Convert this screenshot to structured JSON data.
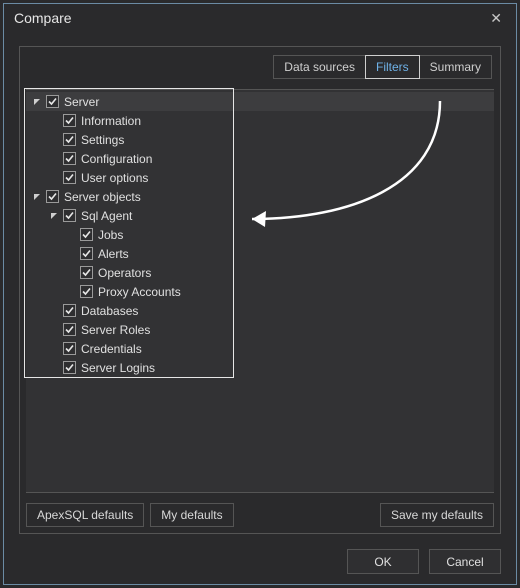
{
  "window": {
    "title": "Compare"
  },
  "tabs": [
    {
      "label": "Data sources",
      "active": false
    },
    {
      "label": "Filters",
      "active": true
    },
    {
      "label": "Summary",
      "active": false
    }
  ],
  "tree": [
    {
      "indent": 0,
      "expanded": true,
      "checked": true,
      "label": "Server",
      "selected": true
    },
    {
      "indent": 1,
      "expanded": null,
      "checked": true,
      "label": "Information"
    },
    {
      "indent": 1,
      "expanded": null,
      "checked": true,
      "label": "Settings"
    },
    {
      "indent": 1,
      "expanded": null,
      "checked": true,
      "label": "Configuration"
    },
    {
      "indent": 1,
      "expanded": null,
      "checked": true,
      "label": "User options"
    },
    {
      "indent": 0,
      "expanded": true,
      "checked": true,
      "label": "Server objects"
    },
    {
      "indent": 1,
      "expanded": true,
      "checked": true,
      "label": "Sql Agent"
    },
    {
      "indent": 2,
      "expanded": null,
      "checked": true,
      "label": "Jobs"
    },
    {
      "indent": 2,
      "expanded": null,
      "checked": true,
      "label": "Alerts"
    },
    {
      "indent": 2,
      "expanded": null,
      "checked": true,
      "label": "Operators"
    },
    {
      "indent": 2,
      "expanded": null,
      "checked": true,
      "label": "Proxy Accounts"
    },
    {
      "indent": 1,
      "expanded": null,
      "checked": true,
      "label": "Databases"
    },
    {
      "indent": 1,
      "expanded": null,
      "checked": true,
      "label": "Server Roles"
    },
    {
      "indent": 1,
      "expanded": null,
      "checked": true,
      "label": "Credentials"
    },
    {
      "indent": 1,
      "expanded": null,
      "checked": true,
      "label": "Server Logins"
    }
  ],
  "defaults": {
    "apex": "ApexSQL defaults",
    "my": "My defaults",
    "save": "Save my defaults"
  },
  "footer": {
    "ok": "OK",
    "cancel": "Cancel"
  }
}
